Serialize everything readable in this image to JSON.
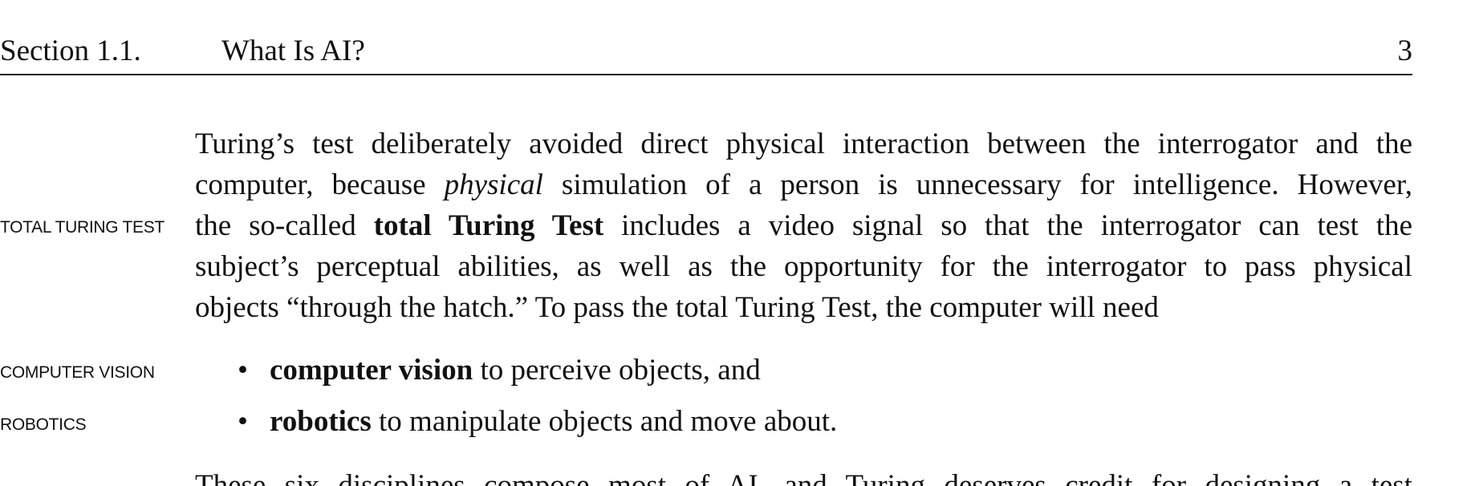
{
  "header": {
    "section": "Section 1.1.",
    "title": "What Is AI?",
    "page_number": "3"
  },
  "margin_notes": {
    "total_turing_test": "TOTAL TURING TEST",
    "computer_vision": "COMPUTER VISION",
    "robotics": "ROBOTICS"
  },
  "paragraph1": {
    "line1": "Turing’s test deliberately avoided direct physical interaction between the interrogator and the",
    "line2_pre": "computer, because ",
    "line2_em": "physical",
    "line2_post": " simulation of a person is unnecessary for intelligence. However,",
    "line3_pre": "the so-called ",
    "line3_bold": "total Turing Test",
    "line3_post": " includes a video signal so that the interrogator can test the",
    "line4": "subject’s perceptual abilities, as well as the opportunity for the interrogator to pass physical",
    "line5": "objects “through the hatch.” To pass the total Turing Test, the computer will need"
  },
  "bullets": [
    {
      "bullet": "•",
      "term": "computer vision",
      "text": " to perceive objects, and"
    },
    {
      "bullet": "•",
      "term": "robotics",
      "text": " to manipulate objects and move about."
    }
  ],
  "paragraph2": {
    "line1_partial": "These six disciplines compose most of AI, and Turing deserves credit for designing a test"
  }
}
